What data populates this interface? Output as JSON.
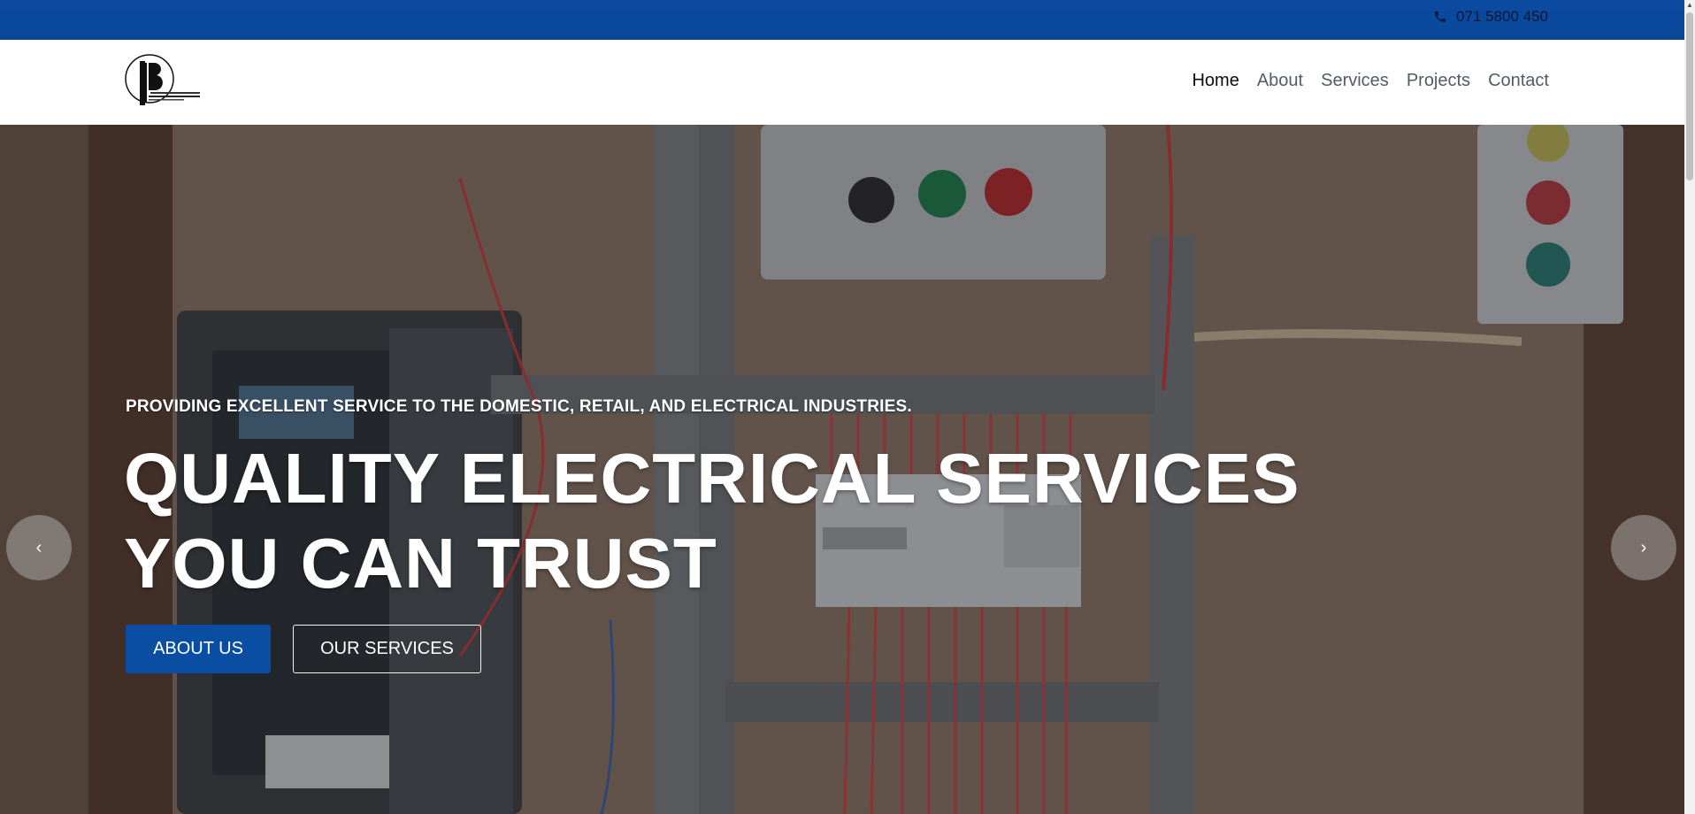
{
  "topbar": {
    "phone": "071 5800 450",
    "phone_icon": "phone-icon",
    "color": "#0a4a9d"
  },
  "header": {
    "logo_alt": "logo",
    "nav": [
      {
        "label": "Home",
        "active": true
      },
      {
        "label": "About",
        "active": false
      },
      {
        "label": "Services",
        "active": false
      },
      {
        "label": "Projects",
        "active": false
      },
      {
        "label": "Contact",
        "active": false
      }
    ]
  },
  "hero": {
    "subtitle": "PROVIDING EXCELLENT SERVICE TO THE DOMESTIC, RETAIL, AND ELECTRICAL INDUSTRIES.",
    "title_line1": "QUALITY ELECTRICAL SERVICES",
    "title_line2": "YOU CAN TRUST",
    "primary_button": "ABOUT US",
    "secondary_button": "OUR SERVICES",
    "prev_arrow": "‹",
    "next_arrow": "›",
    "accent": "#0a4ea3"
  }
}
